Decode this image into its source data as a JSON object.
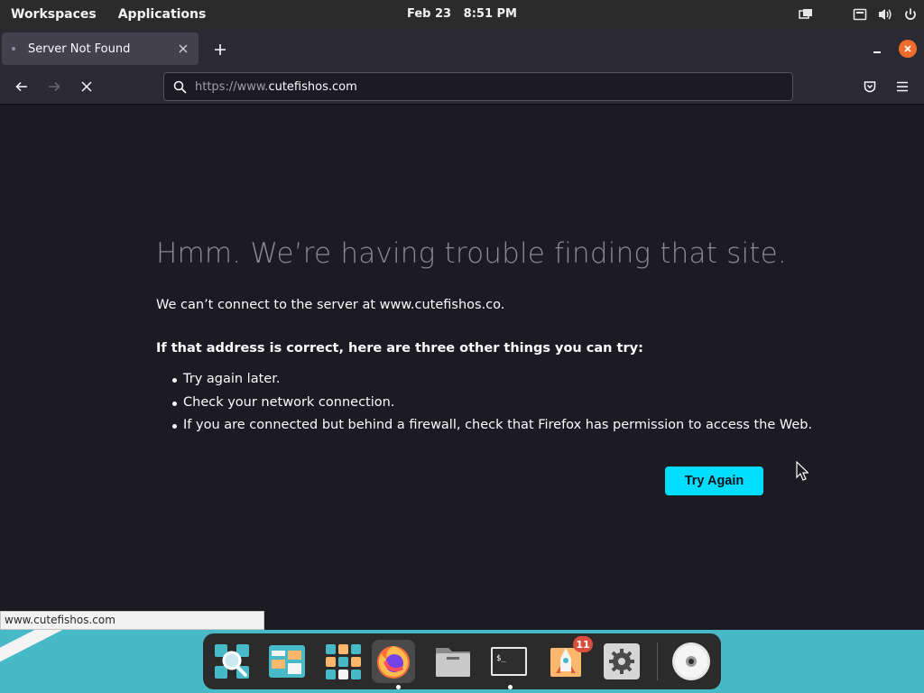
{
  "topbar": {
    "workspaces": "Workspaces",
    "applications": "Applications",
    "date": "Feb 23",
    "time": "8:51 PM"
  },
  "browser": {
    "tab_title": "Server Not Found",
    "url_prefix": "https://www.",
    "url_host": "cutefishos.com"
  },
  "error_page": {
    "title": "Hmm. We’re having trouble finding that site.",
    "description": "We can’t connect to the server at www.cutefishos.co.",
    "subtitle": "If that address is correct, here are three other things you can try:",
    "tips": [
      "Try again later.",
      "Check your network connection.",
      "If you are connected but behind a firewall, check that Firefox has permission to access the Web."
    ],
    "try_again_label": "Try Again"
  },
  "status_link": "www.cutefishos.com",
  "dock": {
    "items": [
      "search-icon",
      "files-layout-icon",
      "app-grid-icon",
      "firefox-icon",
      "file-manager-icon",
      "terminal-icon",
      "app-store-icon",
      "settings-icon",
      "disc-icon"
    ],
    "notification_badge": "11",
    "terminal_prompt": "$_"
  },
  "colors": {
    "accent_button": "#00ddff",
    "close_button": "#f06c2d",
    "desktop": "#48b9c7"
  }
}
